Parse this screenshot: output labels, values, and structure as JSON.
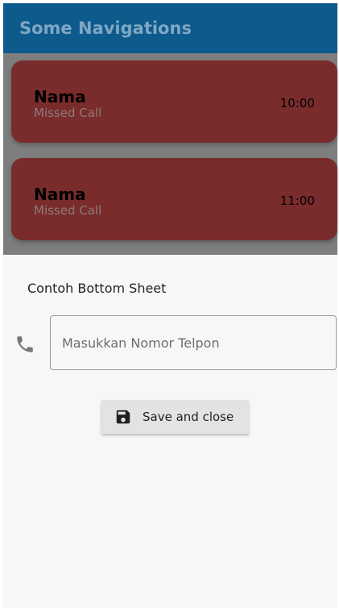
{
  "app_bar": {
    "title": "Some Navigations",
    "color": "#0d5a8c"
  },
  "list": {
    "items": [
      {
        "name": "Nama",
        "subtitle": "Missed Call",
        "time": "10:00"
      },
      {
        "name": "Nama",
        "subtitle": "Missed Call",
        "time": "11:00"
      }
    ],
    "card_color": "#7a2b2b"
  },
  "bottom_sheet": {
    "title": "Contoh Bottom Sheet",
    "phone_input": {
      "icon": "phone-icon",
      "value": "",
      "placeholder": "Masukkan Nomor Telpon"
    },
    "save_button": {
      "icon": "save-icon",
      "label": "Save and close"
    }
  }
}
